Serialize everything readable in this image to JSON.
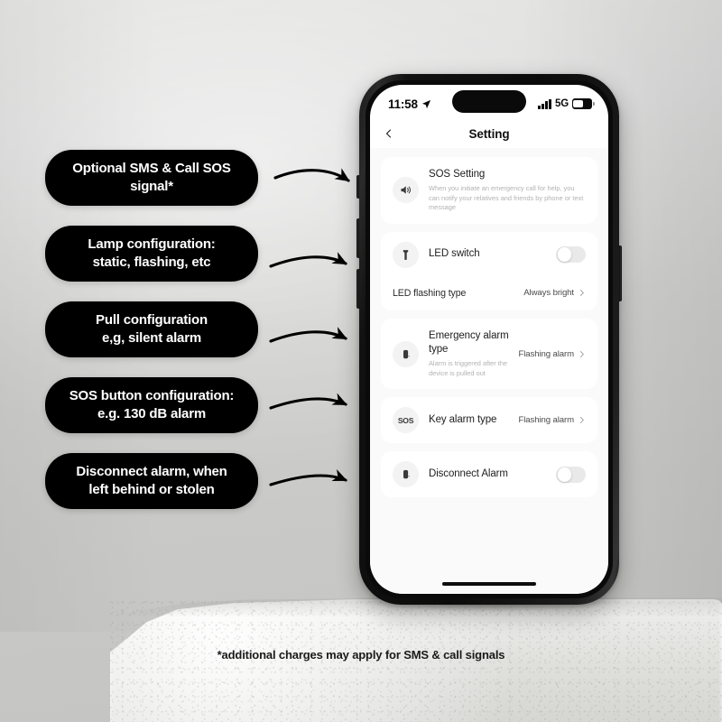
{
  "scene": {
    "background_top_color": "#e2e2e0",
    "background_bottom_color": "#c4c4c2",
    "plinth_color": "#e8e8e6"
  },
  "footnote": {
    "text": "*additional charges may apply for SMS & call signals"
  },
  "callouts": [
    {
      "id": "sms-call-sos",
      "line1": "Optional SMS & Call SOS",
      "line2": "signal*"
    },
    {
      "id": "lamp-configuration",
      "line1": "Lamp configuration:",
      "line2": "static, flashing, etc"
    },
    {
      "id": "pull-configuration",
      "line1": "Pull configuration",
      "line2": "e,g, silent alarm"
    },
    {
      "id": "sos-button-configuration",
      "line1": "SOS button configuration:",
      "line2": "e.g. 130 dB alarm"
    },
    {
      "id": "disconnect-alarm",
      "line1": "Disconnect alarm, when",
      "line2": "left behind or stolen"
    }
  ],
  "phone": {
    "status_bar": {
      "time": "11:58",
      "location_icon": "location-arrow-icon",
      "signal_icon": "signal-bars-icon",
      "network": "5G",
      "battery_icon": "battery-icon",
      "battery_level_percent": 50
    },
    "nav": {
      "back_icon": "chevron-left-icon",
      "title": "Setting"
    },
    "settings": [
      {
        "id": "sos-setting",
        "icon": "speaker-icon",
        "title": "SOS Setting",
        "subtitle": "When you initiate an emergency call for help, you can notify your relatives and friends by phone or text message",
        "control": "none"
      },
      {
        "id": "led-switch",
        "icon": "flashlight-icon",
        "title": "LED switch",
        "control": "toggle",
        "toggle_state": "off",
        "sub_row": {
          "id": "led-flashing-type",
          "title": "LED flashing type",
          "value": "Always bright",
          "chevron": "chevron-right-icon"
        }
      },
      {
        "id": "emergency-alarm-type",
        "icon": "device-icon",
        "title": "Emergency alarm type",
        "subtitle": "Alarm is triggered after the device is pulled out",
        "value": "Flashing alarm",
        "chevron": "chevron-right-icon",
        "control": "value"
      },
      {
        "id": "key-alarm-type",
        "icon": "sos-badge-icon",
        "icon_text": "SOS",
        "title": "Key alarm type",
        "value": "Flashing alarm",
        "chevron": "chevron-right-icon",
        "control": "value"
      },
      {
        "id": "disconnect-alarm",
        "icon": "device-icon",
        "title": "Disconnect Alarm",
        "control": "toggle",
        "toggle_state": "off"
      }
    ],
    "home_indicator": "home-indicator"
  }
}
